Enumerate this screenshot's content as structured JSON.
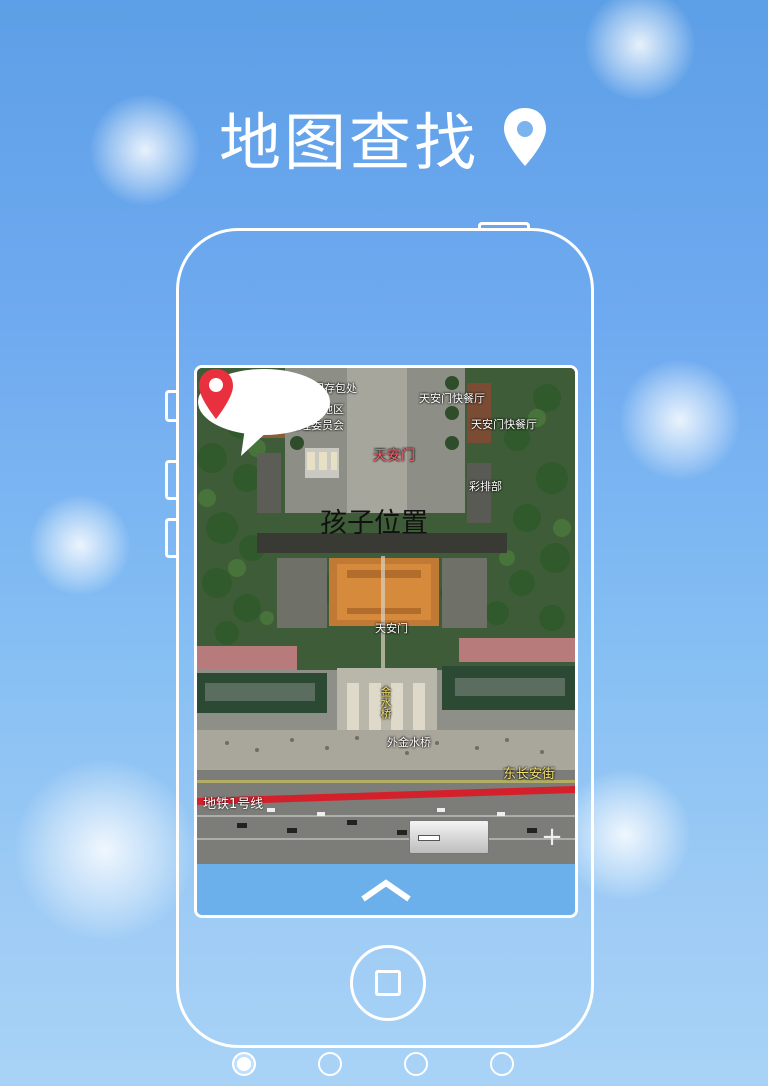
{
  "header": {
    "title": "地图查找",
    "icon": "location-pin-icon"
  },
  "map": {
    "callout_text": "孩子位置",
    "labels": {
      "tam_storage": "天安门存包处",
      "tam_admin_1": "天安门地区",
      "tam_admin_2": "管理委员会",
      "tam_fastfood_top": "天安门快餐厅",
      "tam_fastfood_right": "天安门快餐厅",
      "tiananmen": "天安门",
      "caipai": "彩排部",
      "gate_small": "天安门",
      "jinshui": "金水桥",
      "waijinshui": "外金水桥",
      "changan": "东长安街",
      "metro": "地铁1号线"
    },
    "zoom_out_icon": "minus-icon",
    "zoom_in_icon": "plus-icon"
  },
  "bottom_bar": {
    "icon": "chevron-up-icon"
  },
  "phone": {
    "home_icon": "home-square-icon"
  },
  "pagination": {
    "count": 4,
    "active_index": 0
  },
  "colors": {
    "pin": "#e8303e",
    "metro_line": "#d4202b",
    "accent_bar": "#6bb0ea"
  }
}
